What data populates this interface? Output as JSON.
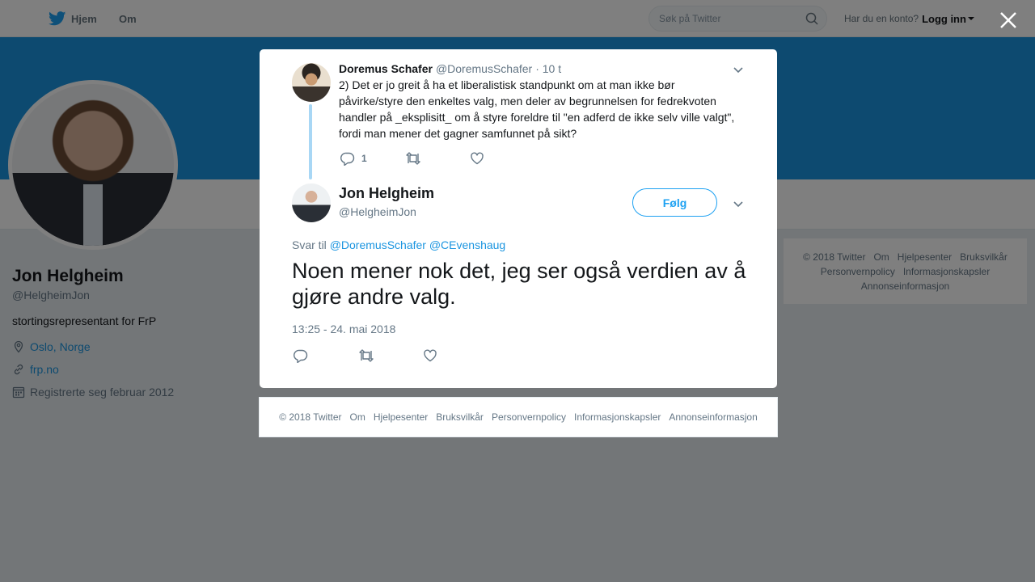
{
  "topnav": {
    "home_label": "Hjem",
    "about_label": "Om",
    "search_placeholder": "Søk på Twitter",
    "login_prompt": "Har du en konto?",
    "login_label": "Logg inn"
  },
  "profile": {
    "name": "Jon Helgheim",
    "handle": "@HelgheimJon",
    "bio": "stortingsrepresentant for FrP",
    "location": "Oslo, Norge",
    "url": "frp.no",
    "joined": "Registrerte seg februar 2012"
  },
  "side_footer": {
    "items": [
      "© 2018 Twitter",
      "Om",
      "Hjelpesenter",
      "Bruksvilkår",
      "Personvernpolicy",
      "Informasjonskapsler",
      "Annonseinformasjon"
    ]
  },
  "parent_tweet": {
    "name": "Doremus Schafer",
    "handle": "@DoremusSchafer",
    "time": "· 10 t",
    "text": "2) Det er jo greit å ha et liberalistisk standpunkt om at man ikke  bør\npåvirke/styre den enkeltes valg, men deler av begrunnelsen for  fedrekvoten\nhandler på _eksplisitt_ om å styre foreldre til \"en adferd de ikke selv ville valgt\",\nfordi man mener det gagner samfunnet på sikt?",
    "reply_count": "1"
  },
  "main_tweet": {
    "name": "Jon Helgheim",
    "handle": "@HelgheimJon",
    "follow_label": "Følg",
    "reply_prefix": "Svar til",
    "reply_to_1": "@DoremusSchafer",
    "reply_to_2": "@CEvenshaug",
    "text": "Noen mener nok det, jeg ser også verdien av å gjøre andre valg.",
    "timestamp": "13:25 - 24. mai 2018"
  },
  "modal_footer": {
    "items": [
      "© 2018 Twitter",
      "Om",
      "Hjelpesenter",
      "Bruksvilkår",
      "Personvernpolicy",
      "Informasjonskapsler",
      "Annonseinformasjon"
    ]
  },
  "colors": {
    "brand": "#1da1f2",
    "link": "#1b95e0",
    "banner": "#1b95e0",
    "overlay": "rgba(0,0,0,0.5)"
  },
  "icons": {
    "logo": "twitter-bird-icon",
    "search": "search-icon",
    "close": "close-icon",
    "reply": "reply-icon",
    "retweet": "retweet-icon",
    "like": "heart-icon",
    "menu": "chevron-down-icon"
  }
}
